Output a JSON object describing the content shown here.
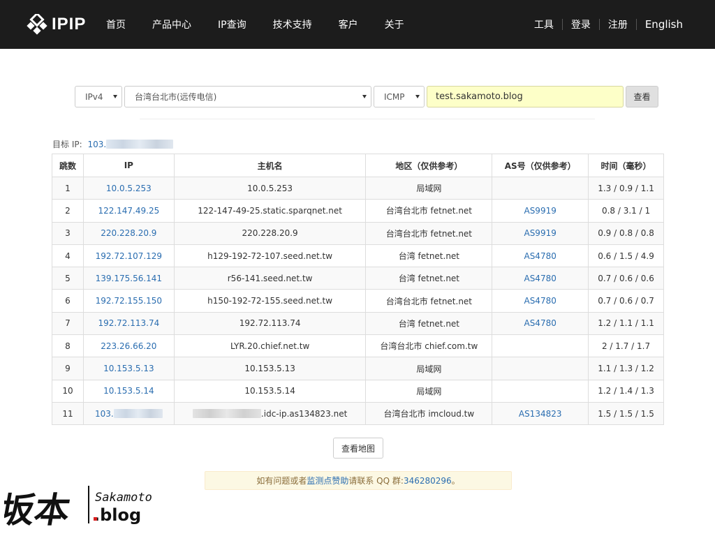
{
  "nav": {
    "logo_text": "IPIP",
    "items": [
      "首页",
      "产品中心",
      "IP查询",
      "技术支持",
      "客户",
      "关于"
    ],
    "right": [
      "工具",
      "登录",
      "注册",
      "English"
    ]
  },
  "query": {
    "ip_version": "IPv4",
    "node": "台湾台北市(远传电信)",
    "protocol": "ICMP",
    "host": "test.sakamoto.blog",
    "submit_label": "查看"
  },
  "target": {
    "label": "目标 IP:",
    "ip_prefix": "103."
  },
  "table": {
    "headers": [
      "跳数",
      "IP",
      "主机名",
      "地区（仅供参考）",
      "AS号（仅供参考）",
      "时间（毫秒）"
    ],
    "rows": [
      [
        "1",
        "10.0.5.253",
        "10.0.5.253",
        "局域网",
        "",
        "1.3 / 0.9 / 1.1"
      ],
      [
        "2",
        "122.147.49.25",
        "122-147-49-25.static.sparqnet.net",
        "台湾台北市 fetnet.net",
        "AS9919",
        "0.8 / 3.1 / 1"
      ],
      [
        "3",
        "220.228.20.9",
        "220.228.20.9",
        "台湾台北市 fetnet.net",
        "AS9919",
        "0.9 / 0.8 / 0.8"
      ],
      [
        "4",
        "192.72.107.129",
        "h129-192-72-107.seed.net.tw",
        "台湾 fetnet.net",
        "AS4780",
        "0.6 / 1.5 / 4.9"
      ],
      [
        "5",
        "139.175.56.141",
        "r56-141.seed.net.tw",
        "台湾 fetnet.net",
        "AS4780",
        "0.7 / 0.6 / 0.6"
      ],
      [
        "6",
        "192.72.155.150",
        "h150-192-72-155.seed.net.tw",
        "台湾台北市 fetnet.net",
        "AS4780",
        "0.7 / 0.6 / 0.7"
      ],
      [
        "7",
        "192.72.113.74",
        "192.72.113.74",
        "台湾 fetnet.net",
        "AS4780",
        "1.2 / 1.1 / 1.1"
      ],
      [
        "8",
        "223.26.66.20",
        "LYR.20.chief.net.tw",
        "台湾台北市 chief.com.tw",
        "",
        "2 / 1.7 / 1.7"
      ],
      [
        "9",
        "10.153.5.13",
        "10.153.5.13",
        "局域网",
        "",
        "1.1 / 1.3 / 1.2"
      ],
      [
        "10",
        "10.153.5.14",
        "10.153.5.14",
        "局域网",
        "",
        "1.2 / 1.4 / 1.3"
      ],
      [
        "11",
        "103.",
        ".idc-ip.as134823.net",
        "台湾台北市 imcloud.tw",
        "AS134823",
        "1.5 / 1.5 / 1.5"
      ]
    ]
  },
  "map_button": "查看地图",
  "notice": {
    "before": "如有问题或者",
    "link": "监测点赞助",
    "middle": "请联系 QQ 群: ",
    "qq": "346280296",
    "after": "。"
  },
  "watermark": {
    "cjk": "坂本",
    "name": "Sakamoto",
    "suffix": ".blog"
  }
}
